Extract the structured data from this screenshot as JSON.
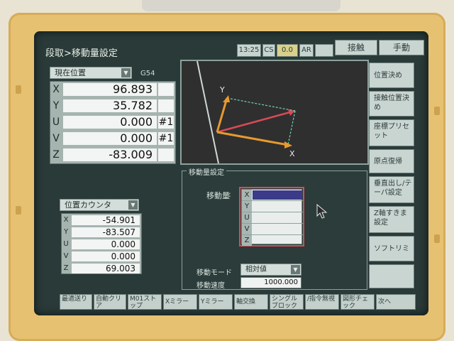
{
  "header": {
    "title": "段取>移動量設定",
    "time": "13:25",
    "cs": "CS",
    "oo": "0.0",
    "ar": "AR",
    "touch_button": "接触",
    "manual_button": "手動"
  },
  "left_panel": {
    "dropdown": "現在位置",
    "work_coord": "G54",
    "positions": [
      {
        "axis": "X",
        "value": "96.893",
        "mark": ""
      },
      {
        "axis": "Y",
        "value": "35.782",
        "mark": ""
      },
      {
        "axis": "U",
        "value": "0.000",
        "mark": "#1"
      },
      {
        "axis": "V",
        "value": "0.000",
        "mark": "#1"
      },
      {
        "axis": "Z",
        "value": "-83.009",
        "mark": ""
      }
    ],
    "counter_dropdown": "位置カウンタ",
    "counters": [
      {
        "axis": "X",
        "value": "-54.901"
      },
      {
        "axis": "Y",
        "value": "-83.507"
      },
      {
        "axis": "U",
        "value": "0.000"
      },
      {
        "axis": "V",
        "value": "0.000"
      },
      {
        "axis": "Z",
        "value": "69.003"
      }
    ]
  },
  "graph": {
    "axis_y_label": "Y",
    "axis_x_label": "X",
    "colors": {
      "axis": "#e69a2f",
      "vector": "#d94a57",
      "dash": "#6ed3b8",
      "background": "#303030"
    }
  },
  "move_panel": {
    "section_title": "移動量設定",
    "amount_label": "移動量",
    "axes": [
      "X",
      "Y",
      "U",
      "V",
      "Z"
    ],
    "mode_label": "移動モード",
    "mode_value": "相対値",
    "speed_label": "移動速度",
    "speed_value": "1000.000"
  },
  "sidebar": [
    {
      "label": "位置決め"
    },
    {
      "label": "接触位置決め"
    },
    {
      "label": "座標プリセット"
    },
    {
      "label": "原点復帰"
    },
    {
      "label": "垂直出し/テーパ設定"
    },
    {
      "label": "Z軸すきま設定"
    },
    {
      "label": "ソフトリミット"
    }
  ],
  "function_keys": [
    {
      "label": "最適送り"
    },
    {
      "label": "自動クリア"
    },
    {
      "label": "M01ストップ"
    },
    {
      "label": "Xミラー"
    },
    {
      "label": "Yミラー"
    },
    {
      "label": "軸交換"
    },
    {
      "label": "シングルブロック"
    },
    {
      "label": "/指令無視"
    },
    {
      "label": "図形チェック"
    },
    {
      "label": "次へ"
    }
  ]
}
